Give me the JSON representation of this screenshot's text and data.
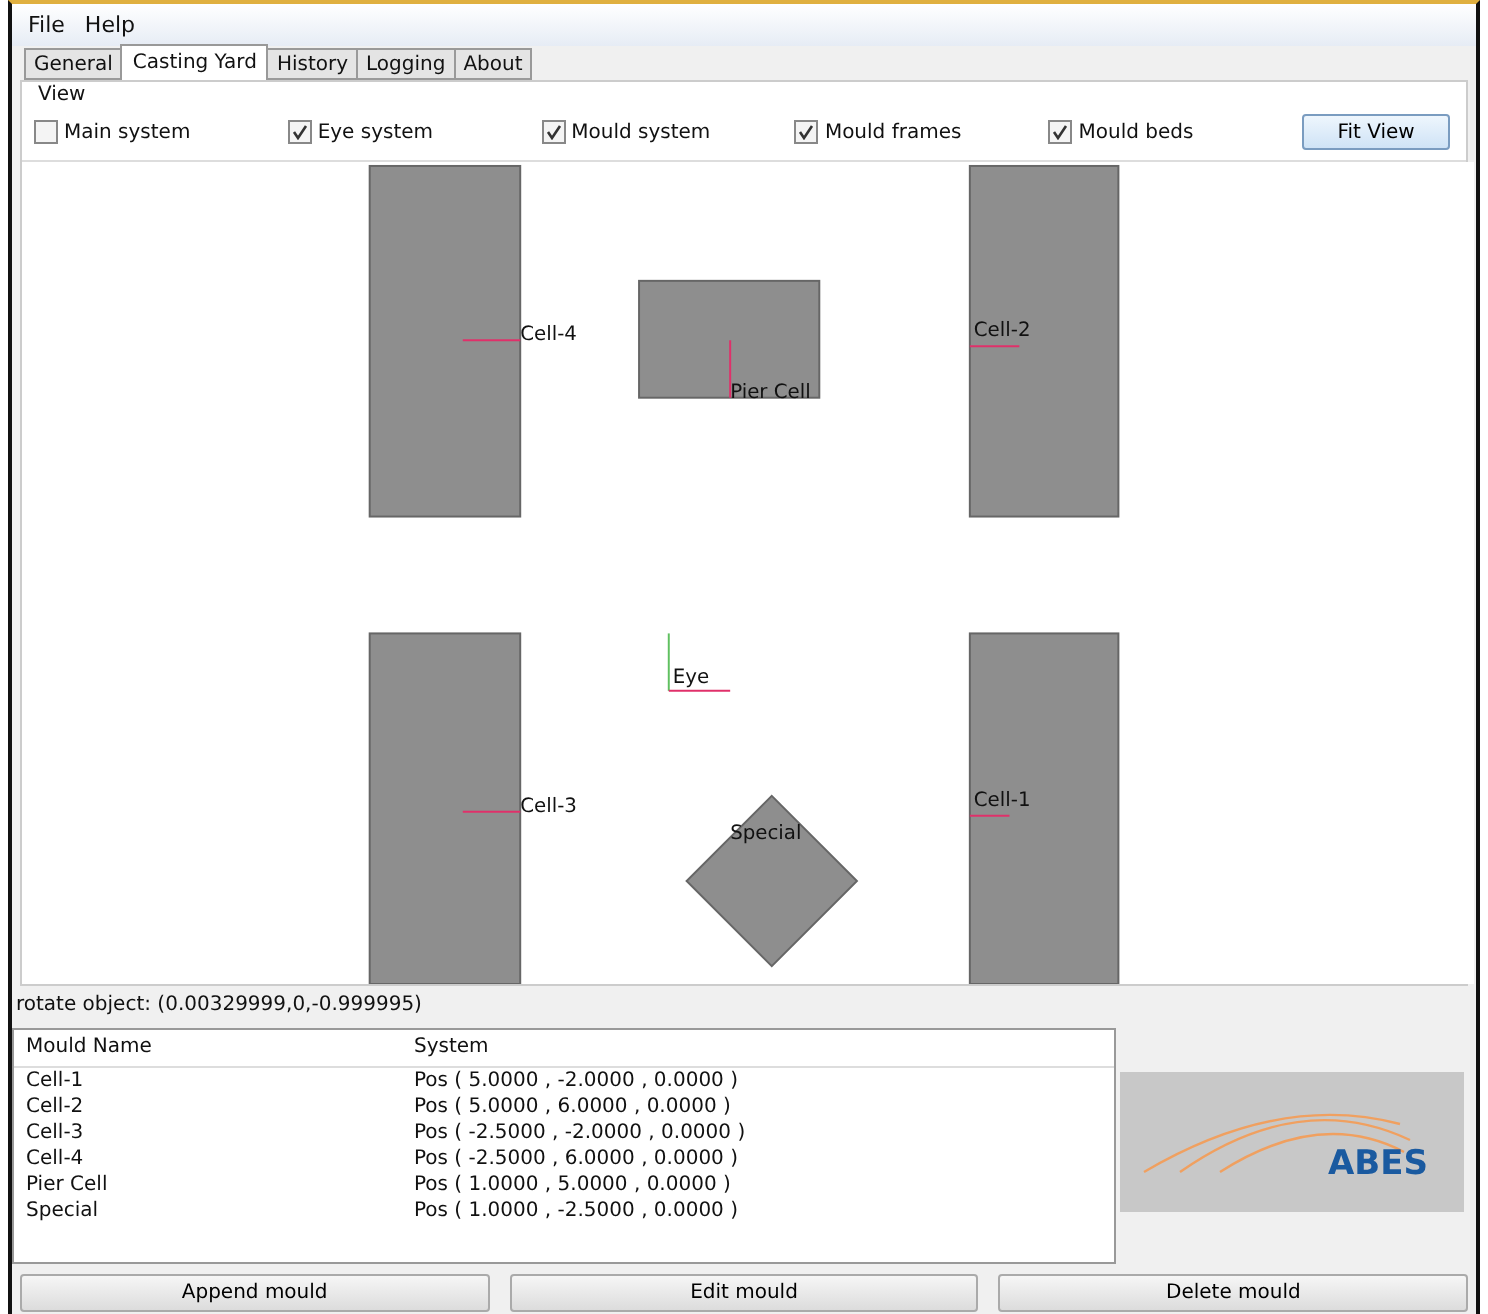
{
  "menu": [
    "File",
    "Help"
  ],
  "tabs": [
    {
      "label": "General",
      "selected": false
    },
    {
      "label": "Casting Yard",
      "selected": true
    },
    {
      "label": "History",
      "selected": false
    },
    {
      "label": "Logging",
      "selected": false
    },
    {
      "label": "About",
      "selected": false
    }
  ],
  "view": {
    "title": "View",
    "options": [
      {
        "label": "Main system",
        "checked": false
      },
      {
        "label": "Eye system",
        "checked": true
      },
      {
        "label": "Mould system",
        "checked": true
      },
      {
        "label": "Mould frames",
        "checked": true
      },
      {
        "label": "Mould beds",
        "checked": true
      }
    ],
    "fit_button": "Fit View"
  },
  "scene": [
    {
      "kind": "bed",
      "label": "Cell-4"
    },
    {
      "kind": "frame",
      "label": "Pier Cell"
    },
    {
      "kind": "bed",
      "label": "Cell-2"
    },
    {
      "kind": "bed",
      "label": "Cell-3"
    },
    {
      "kind": "axes",
      "label": "Eye"
    },
    {
      "kind": "bed",
      "label": "Cell-1"
    },
    {
      "kind": "diamond",
      "label": "Special"
    }
  ],
  "status": "rotate object: (0.00329999,0,-0.999995)",
  "table": {
    "columns": [
      "Mould Name",
      "System"
    ],
    "rows": [
      [
        "Cell-1",
        "Pos ( 5.0000 , -2.0000 , 0.0000 )"
      ],
      [
        "Cell-2",
        "Pos ( 5.0000 , 6.0000 , 0.0000 )"
      ],
      [
        "Cell-3",
        "Pos ( -2.5000 , -2.0000 , 0.0000 )"
      ],
      [
        "Cell-4",
        "Pos ( -2.5000 , 6.0000 , 0.0000 )"
      ],
      [
        "Pier Cell",
        "Pos ( 1.0000 , 5.0000 , 0.0000 )"
      ],
      [
        "Special",
        "Pos ( 1.0000 , -2.5000 , 0.0000 )"
      ]
    ]
  },
  "logo": "ABES",
  "buttons": [
    "Append mould",
    "Edit mould",
    "Delete mould"
  ]
}
